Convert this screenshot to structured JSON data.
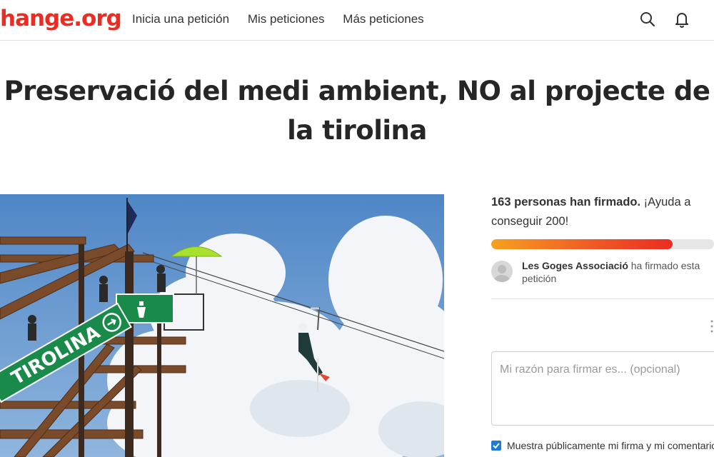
{
  "header": {
    "logo": "hange.org",
    "nav": [
      "Inicia una petición",
      "Mis peticiones",
      "Más peticiones"
    ],
    "icons": [
      "search-icon",
      "bell-icon"
    ]
  },
  "petition": {
    "title": "Preservació del medi ambient, NO al projecte de la tirolina",
    "image": {
      "sign_text": "TIROLINA"
    }
  },
  "sidebar": {
    "signatures_bold": "163 personas han firmado.",
    "signatures_rest": " ¡Ayuda a conseguir 200!",
    "progress": {
      "value": 163,
      "goal": 200,
      "colors": [
        "#f7a020",
        "#ef5b24",
        "#ec2c22"
      ]
    },
    "recent_signer": {
      "name": "Les Goges Associació",
      "action": " ha firmado esta petición"
    },
    "reason_placeholder": "Mi razón para firmar es... (opcional)",
    "consent_label": "Muestra públicamente mi firma y mi comentario",
    "consent_checked": true
  },
  "colors": {
    "brand": "#ec2c22",
    "checkbox": "#1d7bd8",
    "title": "#262626"
  }
}
